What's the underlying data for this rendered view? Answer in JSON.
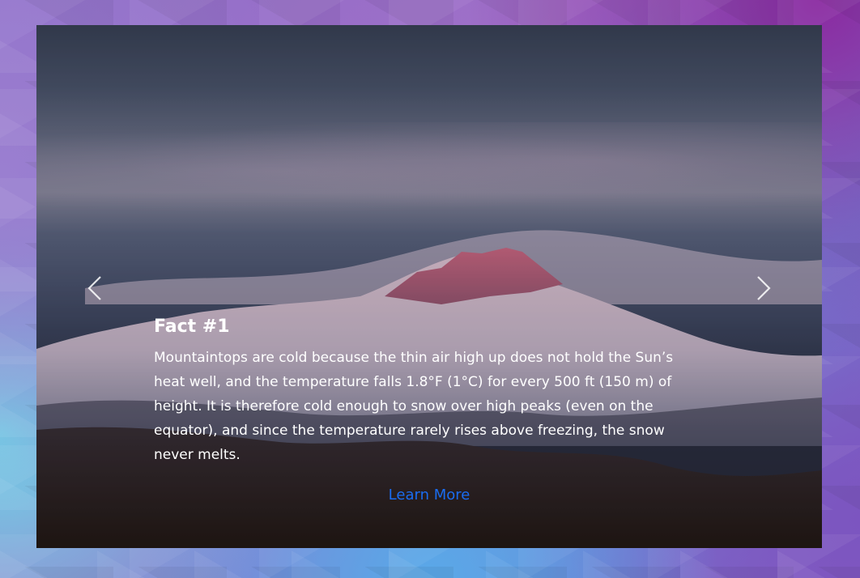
{
  "carousel": {
    "prev_icon": "chevron-left-icon",
    "next_icon": "chevron-right-icon",
    "slide": {
      "title": "Fact #1",
      "text": "Mountaintops are cold because the thin air high up does not hold the Sun’s heat well, and the temperature falls 1.8°F (1°C) for every 500 ft (150 m) of height. It is therefore cold enough to snow over high peaks (even on the equator), and since the temperature rarely rises above freezing, the snow never melts.",
      "link_label": "Learn More"
    }
  },
  "colors": {
    "link": "#1a6cf0",
    "caption_text": "#ffffff"
  }
}
